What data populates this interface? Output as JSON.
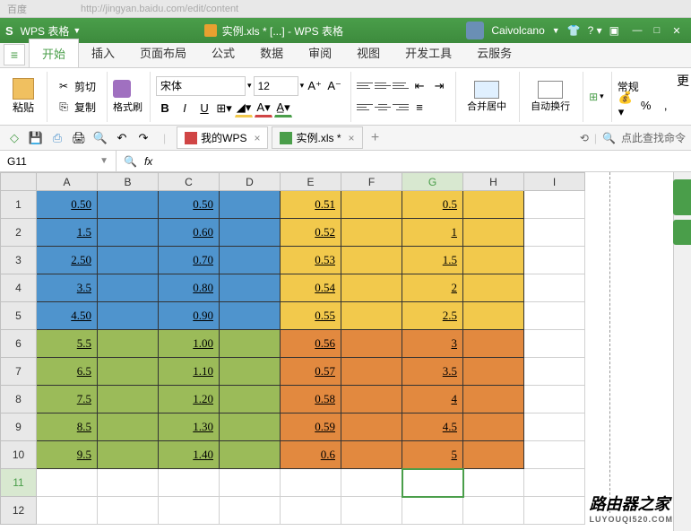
{
  "browser": {
    "url": "http://jingyan.baidu.com/edit/content",
    "prefix": "百度"
  },
  "app": {
    "name": "WPS 表格",
    "title_doc": "实例.xls * [...] - WPS 表格",
    "user": "Caivolcano"
  },
  "menu": {
    "tabs": [
      "开始",
      "插入",
      "页面布局",
      "公式",
      "数据",
      "审阅",
      "视图",
      "开发工具",
      "云服务"
    ],
    "active": 0
  },
  "ribbon": {
    "paste": "粘贴",
    "cut": "剪切",
    "copy": "复制",
    "format_painter": "格式刷",
    "font_name": "宋体",
    "font_size": "12",
    "merge": "合并居中",
    "wrap": "自动换行",
    "number_format": "常规"
  },
  "doc_tabs": [
    {
      "label": "我的WPS",
      "closable": true
    },
    {
      "label": "实例.xls *",
      "closable": true
    }
  ],
  "search_placeholder": "点此查找命令",
  "formula_bar": {
    "cell_ref": "G11",
    "fx": "fx"
  },
  "sheet": {
    "columns": [
      "A",
      "B",
      "C",
      "D",
      "E",
      "F",
      "G",
      "H",
      "I"
    ],
    "selected": {
      "row": 11,
      "col": "G"
    },
    "rows": [
      {
        "n": 1,
        "A": "0.50",
        "C": "0.50",
        "E": "0.51",
        "G": "0.5",
        "zone": "top"
      },
      {
        "n": 2,
        "A": "1.5",
        "C": "0.60",
        "E": "0.52",
        "G": "1",
        "zone": "top"
      },
      {
        "n": 3,
        "A": "2.50",
        "C": "0.70",
        "E": "0.53",
        "G": "1.5",
        "zone": "top"
      },
      {
        "n": 4,
        "A": "3.5",
        "C": "0.80",
        "E": "0.54",
        "G": "2",
        "zone": "top"
      },
      {
        "n": 5,
        "A": "4.50",
        "C": "0.90",
        "E": "0.55",
        "G": "2.5",
        "zone": "top"
      },
      {
        "n": 6,
        "A": "5.5",
        "C": "1.00",
        "E": "0.56",
        "G": "3",
        "zone": "bot"
      },
      {
        "n": 7,
        "A": "6.5",
        "C": "1.10",
        "E": "0.57",
        "G": "3.5",
        "zone": "bot"
      },
      {
        "n": 8,
        "A": "7.5",
        "C": "1.20",
        "E": "0.58",
        "G": "4",
        "zone": "bot"
      },
      {
        "n": 9,
        "A": "8.5",
        "C": "1.30",
        "E": "0.59",
        "G": "4.5",
        "zone": "bot"
      },
      {
        "n": 10,
        "A": "9.5",
        "C": "1.40",
        "E": "0.6",
        "G": "5",
        "zone": "bot"
      },
      {
        "n": 11,
        "zone": "empty"
      },
      {
        "n": 12,
        "zone": "empty"
      }
    ]
  },
  "watermark": {
    "main": "路由器之家",
    "sub": "LUYOUQI520.COM"
  },
  "right_label": "更"
}
